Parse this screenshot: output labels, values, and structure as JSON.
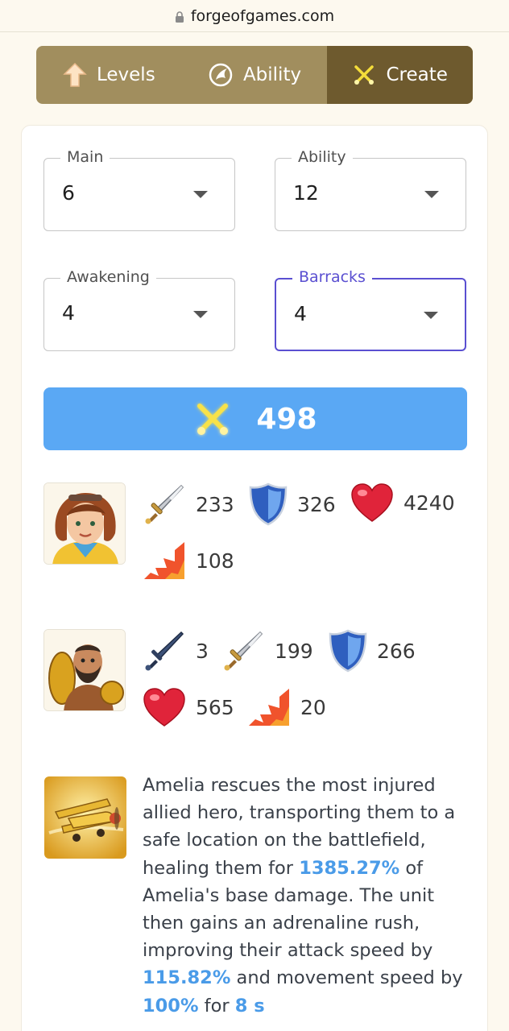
{
  "browser": {
    "url": "forgeofgames.com"
  },
  "tabs": [
    {
      "label": "Levels",
      "icon": "arrow-up-icon",
      "active": false
    },
    {
      "label": "Ability",
      "icon": "ability-icon",
      "active": false
    },
    {
      "label": "Create",
      "icon": "crossed-swords-icon",
      "active": true
    }
  ],
  "selects": {
    "main": {
      "label": "Main",
      "value": "6"
    },
    "ability": {
      "label": "Ability",
      "value": "12"
    },
    "awakening": {
      "label": "Awakening",
      "value": "4"
    },
    "barracks": {
      "label": "Barracks",
      "value": "4"
    }
  },
  "power": {
    "value": "498"
  },
  "hero": {
    "attack": "233",
    "defense": "326",
    "health": "4240",
    "speed": "108"
  },
  "unit": {
    "range": "3",
    "attack": "199",
    "defense": "266",
    "health": "565",
    "speed": "20"
  },
  "ability": {
    "t1": "Amelia rescues the most injured allied hero, transporting them to a safe location on the battlefield, healing them for ",
    "v1": "1385.27%",
    "t2": " of Amelia's base damage. The unit then gains an adrenaline rush, improving their attack speed by ",
    "v2": "115.82%",
    "t3": " and movement speed by ",
    "v3": "100%",
    "t4": " for ",
    "v4": "8 s"
  },
  "colors": {
    "tab_bg": "#a18e5e",
    "tab_active": "#6e5a2e",
    "accent_blue": "#5aa8f4",
    "focus_purple": "#5a4fd1",
    "highlight": "#4a9be8"
  }
}
